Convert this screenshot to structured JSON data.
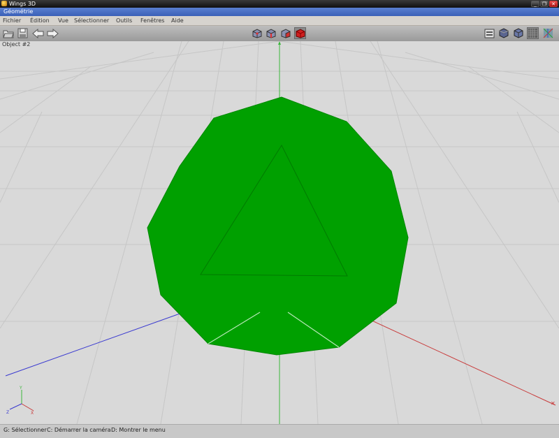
{
  "window": {
    "title": "Wings 3D",
    "buttons": {
      "minimize": "_",
      "maximize": "❐",
      "close": "✕"
    }
  },
  "geometry_bar": {
    "label": "Géométrie"
  },
  "menu": {
    "items": [
      {
        "label": "Fichier"
      },
      {
        "label": "Édition"
      },
      {
        "label": "Vue"
      },
      {
        "label": "Sélectionner"
      },
      {
        "label": "Outils"
      },
      {
        "label": "Fenêtres"
      },
      {
        "label": "Aide"
      }
    ]
  },
  "toolbar": {
    "left": [
      "open-icon",
      "save-icon",
      "undo-arrow-icon",
      "redo-arrow-icon"
    ],
    "center": [
      "vertex-select-icon",
      "edge-select-icon",
      "face-select-icon",
      "body-select-icon"
    ],
    "right": [
      "outliner-icon",
      "smooth-shade-icon",
      "flat-shade-icon",
      "wireframe-icon",
      "grid-view-icon"
    ]
  },
  "viewport": {
    "object_label": "Object #2",
    "colors": {
      "background": "#d9d9d9",
      "mesh": "#00a000",
      "x_axis": "#c83a3a",
      "y_axis": "#3ab63a",
      "z_axis": "#3a3ad0",
      "grid": "#c6c6c6"
    },
    "mini_axis": {
      "x_label": "X",
      "y_label": "Y",
      "z_label": "Z"
    }
  },
  "statusbar": {
    "items": [
      "G: Sélectionner",
      "C: Démarrer la caméra",
      "D: Montrer le menu"
    ]
  }
}
